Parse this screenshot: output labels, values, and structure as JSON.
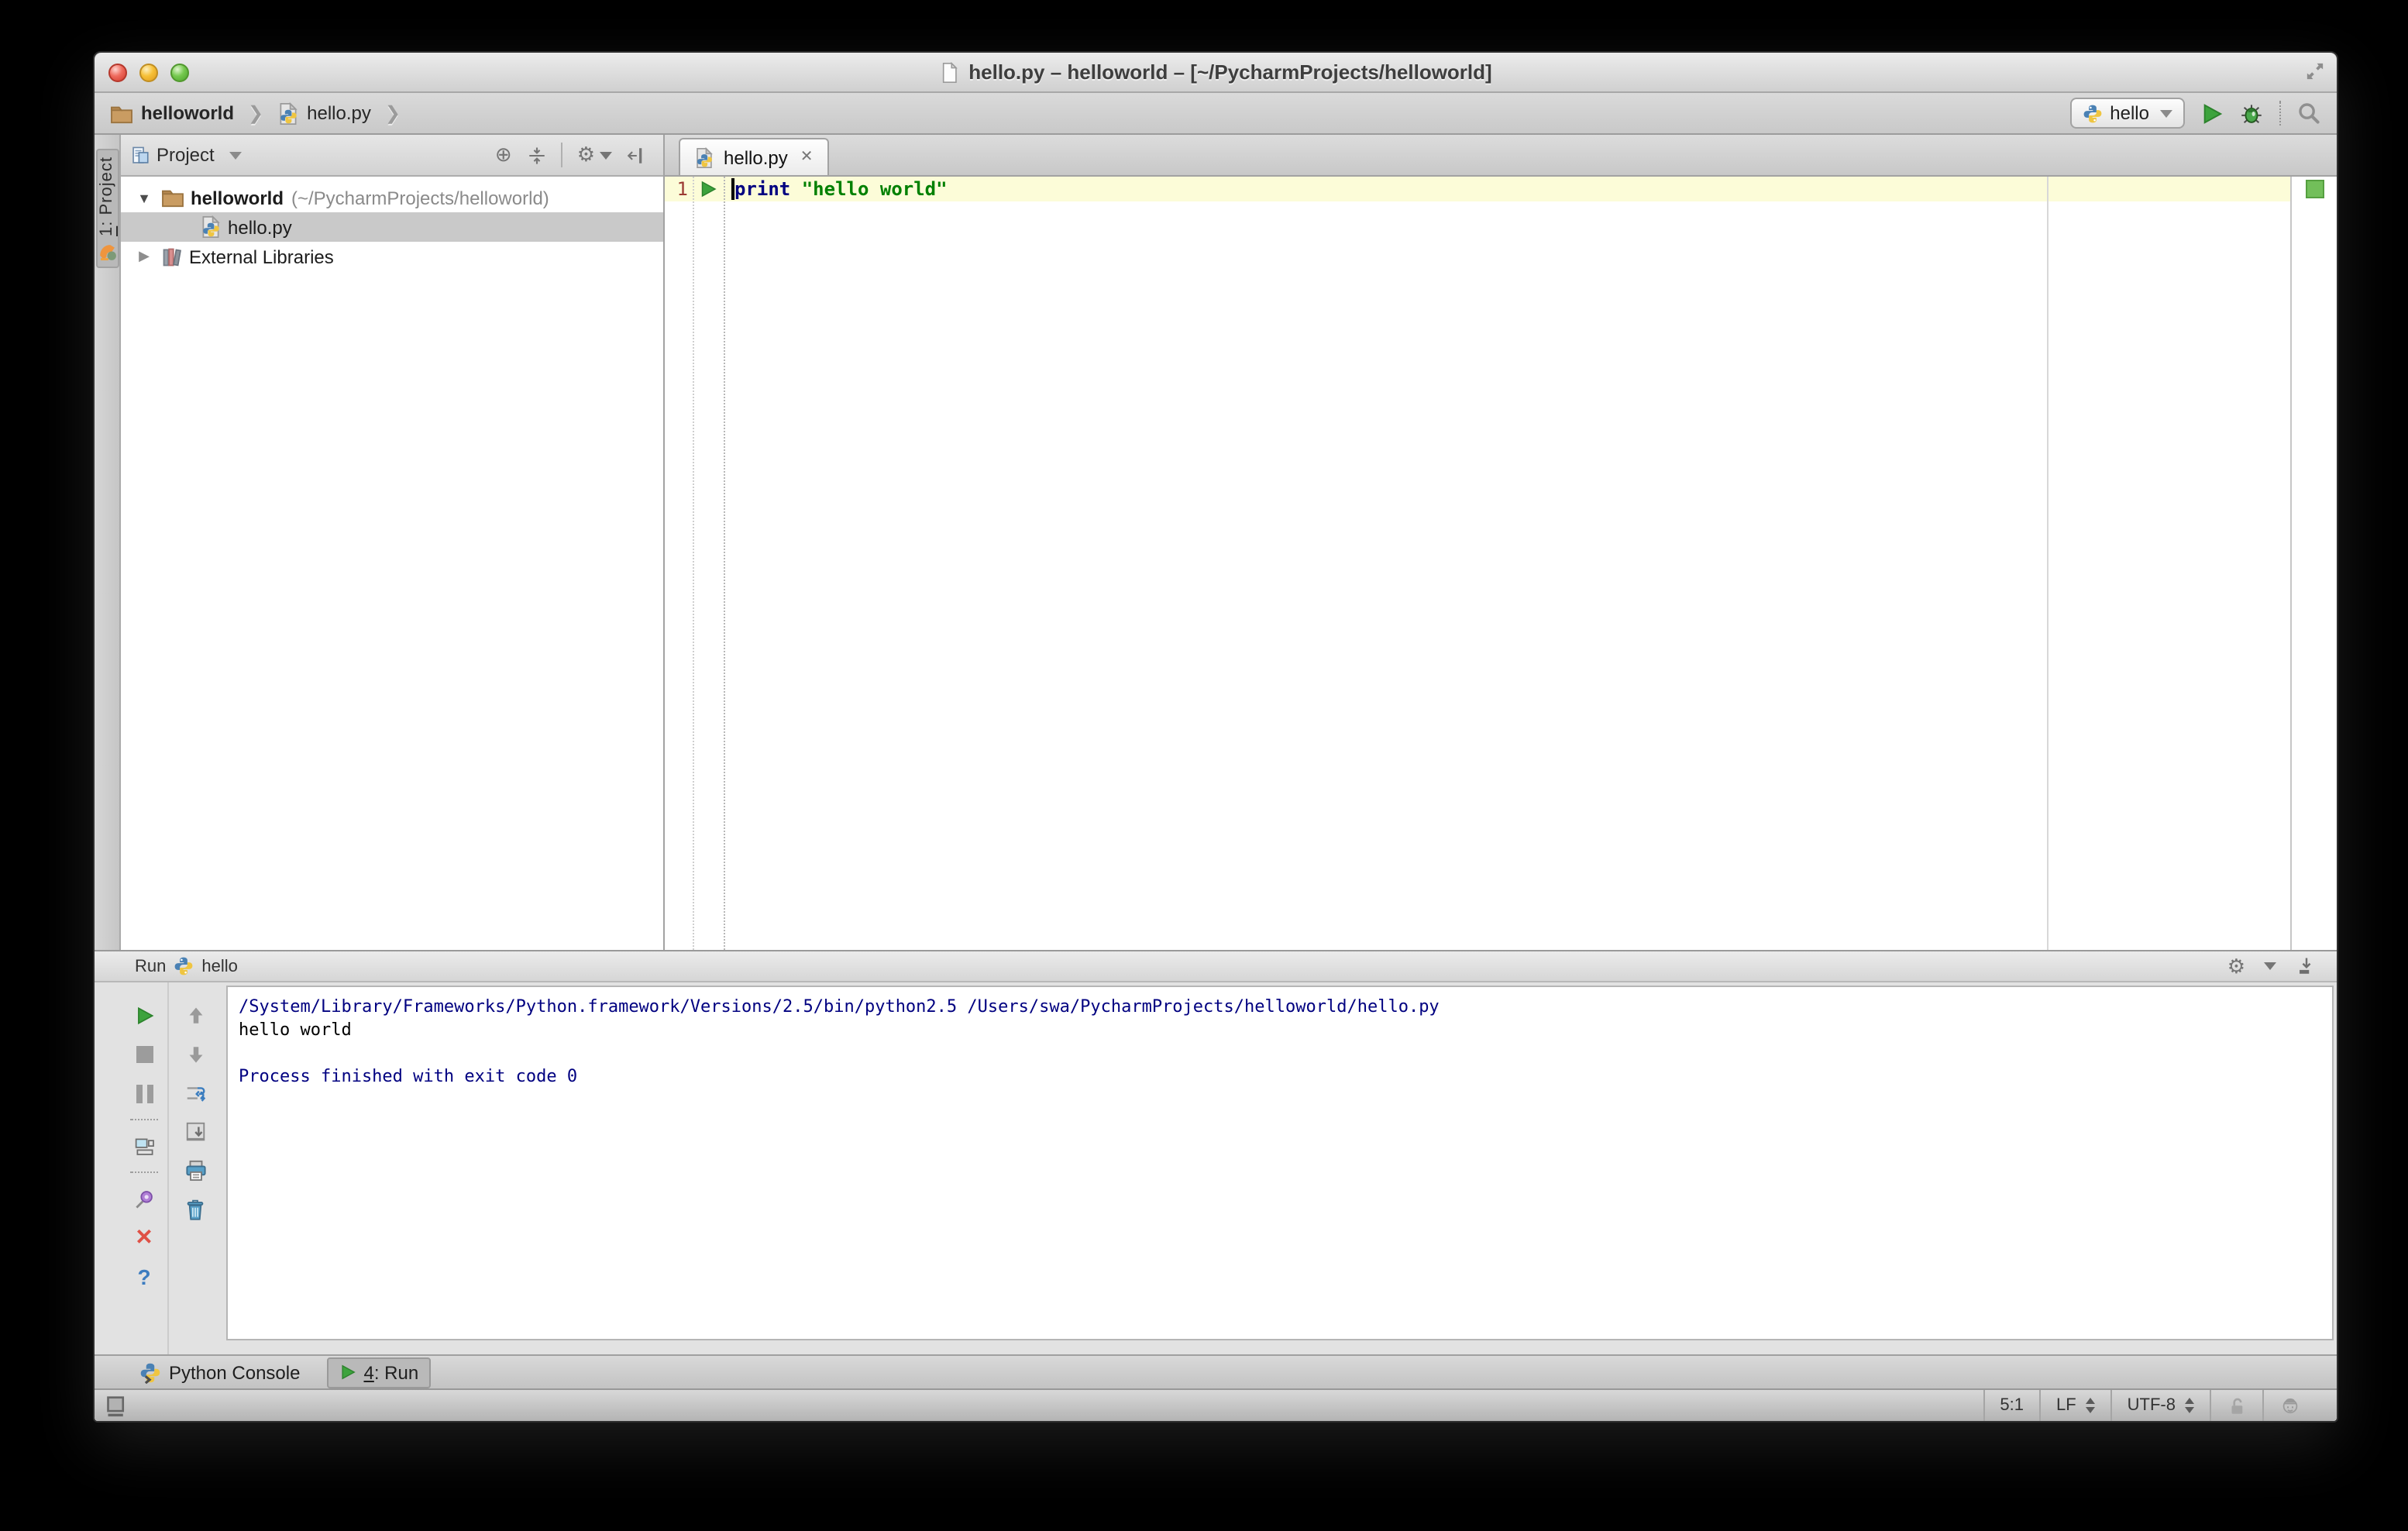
{
  "window": {
    "title": "hello.py – helloworld – [~/PycharmProjects/helloworld]"
  },
  "navbar": {
    "breadcrumbs": [
      {
        "label": "helloworld"
      },
      {
        "label": "hello.py"
      }
    ],
    "run_config": {
      "label": "hello"
    }
  },
  "project_panel": {
    "stripe_tab": {
      "number": "1",
      "suffix": ": Project"
    },
    "header": {
      "title": "Project"
    },
    "tree": {
      "root": {
        "name": "helloworld",
        "path": "(~/PycharmProjects/helloworld)"
      },
      "file": {
        "name": "hello.py"
      },
      "libraries": {
        "name": "External Libraries"
      }
    }
  },
  "editor": {
    "tab": {
      "label": "hello.py"
    },
    "gutter": {
      "line_number": "1"
    },
    "code": {
      "keyword": "print",
      "string": "\"hello world\""
    }
  },
  "run_panel": {
    "header": {
      "title": "Run",
      "config": "hello"
    },
    "console_lines": [
      {
        "text": "/System/Library/Frameworks/Python.framework/Versions/2.5/bin/python2.5 /Users/swa/PycharmProjects/helloworld/hello.py",
        "type": "system"
      },
      {
        "text": "hello world",
        "type": "stdout"
      },
      {
        "text": "",
        "type": "blank"
      },
      {
        "text": "Process finished with exit code 0",
        "type": "system"
      }
    ]
  },
  "bottom_bar": {
    "tabs": [
      {
        "label": "Python Console"
      },
      {
        "number": "4",
        "suffix": ": Run"
      }
    ]
  },
  "status_bar": {
    "caret_position": "5:1",
    "line_separator": "LF",
    "encoding": "UTF-8"
  },
  "glyphs": {
    "breadcrumb_chevron": "❯",
    "tree_expanded": "▼",
    "tree_collapsed": "▶",
    "close": "✕",
    "gear": "⚙",
    "target": "⊕",
    "dropdown": "▾",
    "help": "?",
    "cross": "✕"
  },
  "colors": {
    "keyword": "#000080",
    "string": "#008000",
    "console_system": "#000080",
    "console_stdout": "#000000",
    "current_line": "#FCFCD8",
    "tree_selection": "#C9C9C9",
    "run_green": "#3DA33D",
    "inspection_ok": "#72BF5A"
  }
}
